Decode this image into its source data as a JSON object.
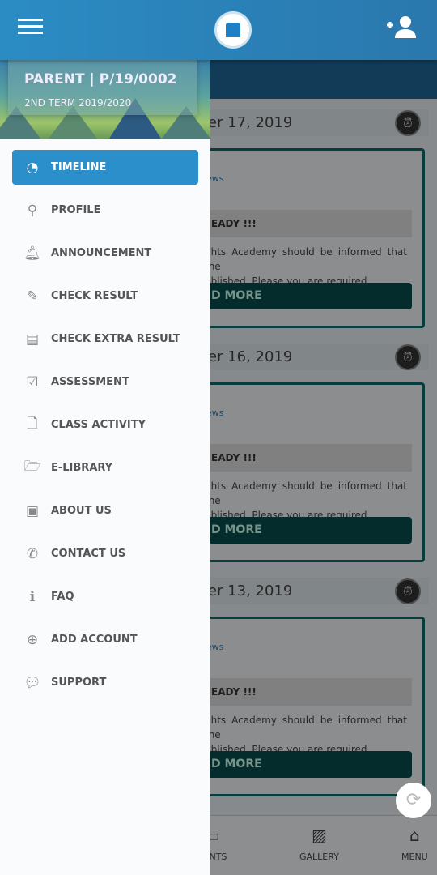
{
  "header": {
    "menu_icon": "hamburger-icon",
    "logo": "school-logo",
    "add_user_icon": "add-user-icon"
  },
  "drawer": {
    "user": "PARENT | P/19/0002",
    "term": "2ND TERM 2019/2020",
    "items": [
      {
        "label": "TIMELINE",
        "icon": "dashboard-icon",
        "active": true
      },
      {
        "label": "PROFILE",
        "icon": "person-pin-icon"
      },
      {
        "label": "ANNOUNCEMENT",
        "icon": "bell-icon"
      },
      {
        "label": "CHECK RESULT",
        "icon": "edit-icon"
      },
      {
        "label": "CHECK EXTRA RESULT",
        "icon": "newspaper-icon"
      },
      {
        "label": "ASSESSMENT",
        "icon": "checkbox-icon"
      },
      {
        "label": "CLASS ACTIVITY",
        "icon": "file-icon"
      },
      {
        "label": "E-LIBRARY",
        "icon": "folder-open-icon"
      },
      {
        "label": "ABOUT US",
        "icon": "id-card-icon"
      },
      {
        "label": "CONTACT US",
        "icon": "phone-icon"
      },
      {
        "label": "FAQ",
        "icon": "info-icon"
      },
      {
        "label": "ADD ACCOUNT",
        "icon": "plus-circle-icon"
      },
      {
        "label": "SUPPORT",
        "icon": "comments-icon"
      }
    ]
  },
  "timeline": [
    {
      "date": "er 17, 2019",
      "category": "ews",
      "title": "EADY !!!",
      "body_line1": "ghts Academy should be informed that the",
      "body_line2": "ublished. Please you are required ...",
      "button": "D MORE"
    },
    {
      "date": "er 16, 2019",
      "category": "ews",
      "title": "EADY !!!",
      "body_line1": "ghts Academy should be informed that the",
      "body_line2": "ublished. Please you are required ...",
      "button": "D MORE"
    },
    {
      "date": "er 13, 2019",
      "category": "ews",
      "title": "EADY !!!",
      "body_line1": "ghts Academy should be informed that the",
      "body_line2": "ublished. Please you are required ...",
      "button": "D MORE"
    }
  ],
  "bottom_nav": [
    {
      "label": "VENTS",
      "icon": "calendar-icon"
    },
    {
      "label": "GALLERY",
      "icon": "image-icon"
    },
    {
      "label": "MENU",
      "icon": "home-icon"
    }
  ],
  "refresh_icon": "refresh-icon"
}
